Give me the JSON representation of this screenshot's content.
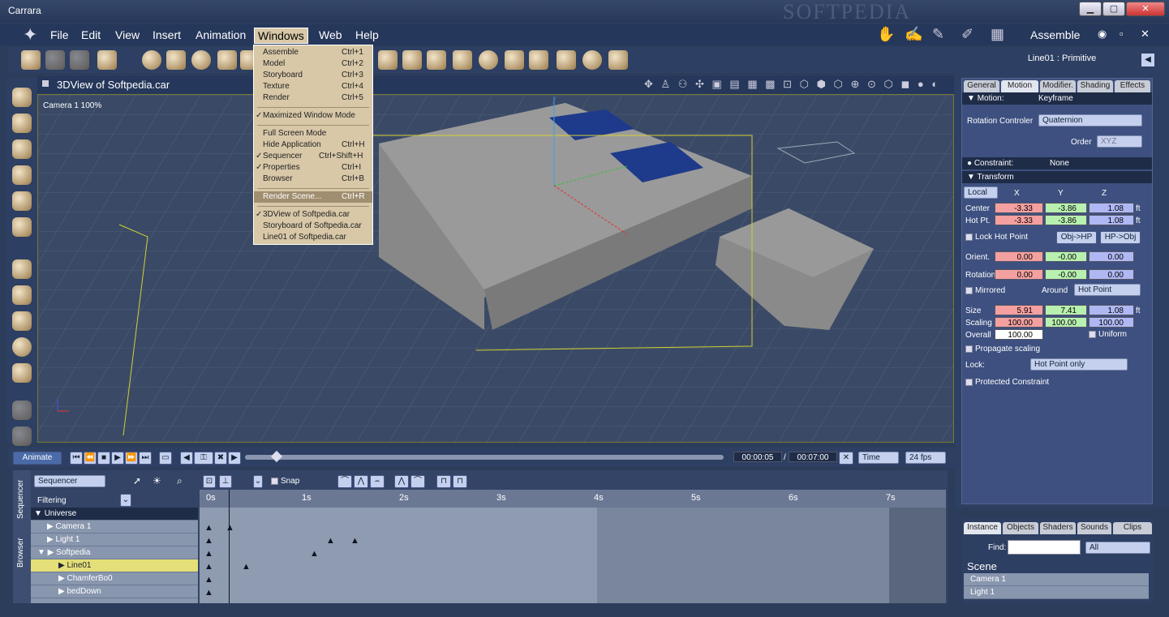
{
  "window": {
    "title": "Carrara",
    "watermark": "SOFTPEDIA"
  },
  "menubar": {
    "items": [
      "File",
      "Edit",
      "View",
      "Insert",
      "Animation",
      "Windows",
      "Web",
      "Help"
    ],
    "active": "Windows"
  },
  "mode": {
    "label": "Assemble"
  },
  "windows_menu": {
    "group1": [
      {
        "label": "Assemble",
        "shortcut": "Ctrl+1"
      },
      {
        "label": "Model",
        "shortcut": "Ctrl+2"
      },
      {
        "label": "Storyboard",
        "shortcut": "Ctrl+3"
      },
      {
        "label": "Texture",
        "shortcut": "Ctrl+4"
      },
      {
        "label": "Render",
        "shortcut": "Ctrl+5"
      }
    ],
    "group2": [
      {
        "label": "Maximized Window Mode",
        "shortcut": "",
        "checked": true
      }
    ],
    "group3": [
      {
        "label": "Full Screen Mode",
        "shortcut": "",
        "checked": false
      },
      {
        "label": "Hide Application",
        "shortcut": "Ctrl+H",
        "checked": false
      },
      {
        "label": "Sequencer",
        "shortcut": "Ctrl+Shift+H",
        "checked": true
      },
      {
        "label": "Properties",
        "shortcut": "Ctrl+I",
        "checked": true
      },
      {
        "label": "Browser",
        "shortcut": "Ctrl+B",
        "checked": false
      }
    ],
    "group4": [
      {
        "label": "Render Scene...",
        "shortcut": "Ctrl+R"
      }
    ],
    "group5": [
      {
        "label": "3DView of Softpedia.car",
        "checked": true
      },
      {
        "label": "Storyboard of Softpedia.car",
        "checked": false
      },
      {
        "label": "Line01 of Softpedia.car",
        "checked": false
      }
    ]
  },
  "view": {
    "title": "3DView of Softpedia.car",
    "camera": "Camera 1 100%"
  },
  "properties": {
    "title": "Line01 : Primitive",
    "tabs": [
      "General",
      "Motion",
      "Modifier.",
      "Shading",
      "Effects"
    ],
    "active_tab": "Motion",
    "motion": {
      "label": "Motion:",
      "value": "Keyframe"
    },
    "rotation_controller": {
      "label": "Rotation Controler",
      "value": "Quaternion"
    },
    "order": {
      "label": "Order",
      "value": "XYZ"
    },
    "constraint": {
      "label": "Constraint:",
      "value": "None"
    },
    "transform": {
      "label": "Transform",
      "space": "Local",
      "cols": [
        "X",
        "Y",
        "Z"
      ],
      "unit": "ft",
      "center": {
        "label": "Center",
        "x": "-3.33",
        "y": "-3.86",
        "z": "1.08"
      },
      "hotpt": {
        "label": "Hot Pt.",
        "x": "-3.33",
        "y": "-3.86",
        "z": "1.08"
      },
      "lock_hot_point": "Lock Hot Point",
      "obj_hp": "Obj->HP",
      "hp_obj": "HP->Obj",
      "orient": {
        "label": "Orient.",
        "x": "0.00",
        "y": "-0.00",
        "z": "0.00"
      },
      "rotation": {
        "label": "Rotation",
        "x": "0.00",
        "y": "-0.00",
        "z": "0.00"
      },
      "mirrored": "Mirrored",
      "around": "Around",
      "around_value": "Hot Point",
      "size": {
        "label": "Size",
        "x": "5.91",
        "y": "7.41",
        "z": "1.08"
      },
      "scaling": {
        "label": "Scaling",
        "x": "100.00",
        "y": "100.00",
        "z": "100.00"
      },
      "overall": {
        "label": "Overall",
        "value": "100.00"
      },
      "uniform": "Uniform",
      "propagate": "Propagate scaling",
      "lock": "Lock:",
      "lock_value": "Hot Point only",
      "protected": "Protected Constraint"
    }
  },
  "transport": {
    "animate": "Animate",
    "current": "00:00:05",
    "total": "00:07:00",
    "time_mode": "Time",
    "fps": "24 fps"
  },
  "sequencer": {
    "tabs": [
      "Sequencer",
      "Browser"
    ],
    "mode": "Sequencer",
    "filtering": "Filtering",
    "snap": "Snap",
    "ruler": [
      "0s",
      "1s",
      "2s",
      "3s",
      "4s",
      "5s",
      "6s",
      "7s"
    ],
    "tracks": [
      {
        "label": "Universe",
        "level": 0,
        "open": true,
        "selected": false
      },
      {
        "label": "Camera 1",
        "level": 1,
        "open": false,
        "selected": false
      },
      {
        "label": "Light 1",
        "level": 1,
        "open": false,
        "selected": false
      },
      {
        "label": "Softpedia",
        "level": 1,
        "open": true,
        "selected": false
      },
      {
        "label": "Line01",
        "level": 2,
        "open": false,
        "selected": true
      },
      {
        "label": "ChamferBo0",
        "level": 2,
        "open": false,
        "selected": false
      },
      {
        "label": "bedDown",
        "level": 2,
        "open": false,
        "selected": false
      }
    ]
  },
  "browser": {
    "tabs": [
      "Instance",
      "Objects",
      "Shaders",
      "Sounds",
      "Clips"
    ],
    "find": "Find:",
    "filter": "All",
    "scene": "Scene",
    "items": [
      "Camera 1",
      "Light 1"
    ]
  }
}
